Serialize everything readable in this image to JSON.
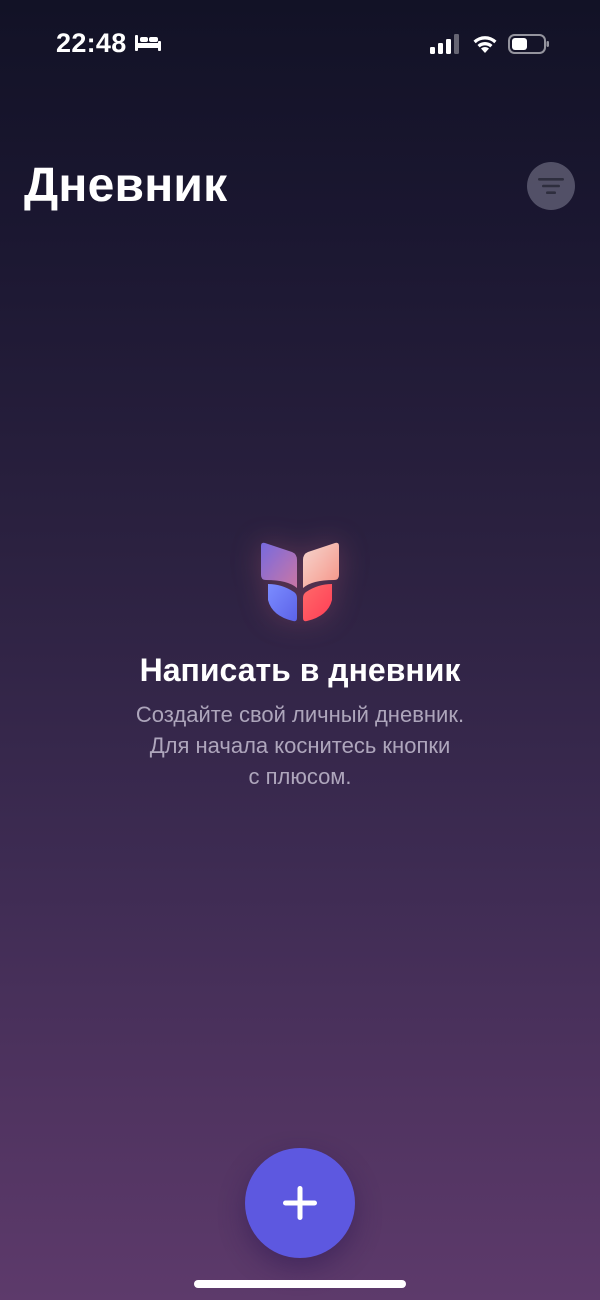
{
  "status_bar": {
    "time": "22:48",
    "focus_icon": "bed-icon",
    "signal_icon": "cellular-signal-icon",
    "wifi_icon": "wifi-icon",
    "battery_icon": "battery-icon",
    "battery_level": 0.5
  },
  "header": {
    "title": "Дневник",
    "filter_icon": "filter-icon"
  },
  "empty_state": {
    "logo_icon": "journal-butterfly-icon",
    "title": "Написать в дневник",
    "lines": [
      "Создайте свой личный дневник.",
      "Для начала коснитесь кнопки",
      "с плюсом."
    ]
  },
  "fab": {
    "icon": "plus-icon",
    "color": "#5d58e0"
  },
  "colors": {
    "background_top": "#121226",
    "background_bottom": "#5d3a6b",
    "accent": "#5d58e0"
  }
}
